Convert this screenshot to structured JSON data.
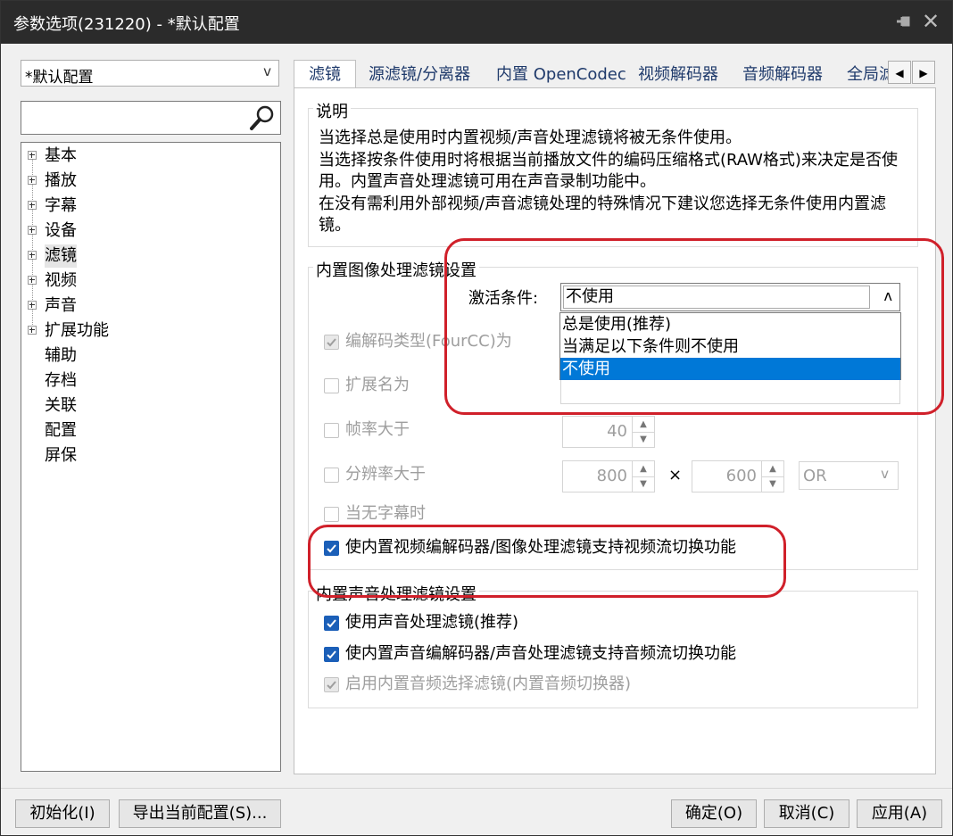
{
  "window": {
    "title": "参数选项(231220) - *默认配置"
  },
  "titlebar_icons": {
    "pin": "pin-icon",
    "close": "close-icon"
  },
  "profile": {
    "selected": "*默认配置"
  },
  "search": {
    "value": ""
  },
  "tree": [
    {
      "label": "基本"
    },
    {
      "label": "播放"
    },
    {
      "label": "字幕"
    },
    {
      "label": "设备"
    },
    {
      "label": "滤镜"
    },
    {
      "label": "视频"
    },
    {
      "label": "声音"
    },
    {
      "label": "扩展功能"
    },
    {
      "label": "辅助"
    },
    {
      "label": "存档"
    },
    {
      "label": "关联"
    },
    {
      "label": "配置"
    },
    {
      "label": "屏保"
    }
  ],
  "tabs": [
    "滤镜",
    "源滤镜/分离器",
    "内置 OpenCodec",
    "视频解码器",
    "音频解码器",
    "全局滤"
  ],
  "description": {
    "title": "说明",
    "lines": [
      "当选择总是使用时内置视频/声音处理滤镜将被无条件使用。",
      "当选择按条件使用时将根据当前播放文件的编码压缩格式(RAW格式)来决定是否使用。内置声音处理滤镜可用在声音录制功能中。",
      "在没有需利用外部视频/声音滤镜处理的特殊情况下建议您选择无条件使用内置滤镜。"
    ]
  },
  "video_group": {
    "title": "内置图像处理滤镜设置",
    "activation_label": "激活条件:",
    "activation_value": "不使用",
    "options": [
      "总是使用(推荐)",
      "当满足以下条件则不使用",
      "不使用"
    ],
    "fourcc_label": "编解码类型(FourCC)为",
    "ext_label": "扩展名为",
    "fps_label": "帧率大于",
    "fps_value": "40",
    "res_label": "分辨率大于",
    "res_w": "800",
    "res_x": "×",
    "res_h": "600",
    "res_op": "OR",
    "nosub_label": "当无字幕时",
    "switch_label": "使内置视频编解码器/图像处理滤镜支持视频流切换功能"
  },
  "audio_group": {
    "title": "内置声音处理滤镜设置",
    "use_label": "使用声音处理滤镜(推荐)",
    "switch_label": "使内置声音编解码器/声音处理滤镜支持音频流切换功能",
    "selector_label": "启用内置音频选择滤镜(内置音频切换器)"
  },
  "buttons": {
    "init": "初始化(I)",
    "export": "导出当前配置(S)...",
    "ok": "确定(O)",
    "cancel": "取消(C)",
    "apply": "应用(A)"
  }
}
